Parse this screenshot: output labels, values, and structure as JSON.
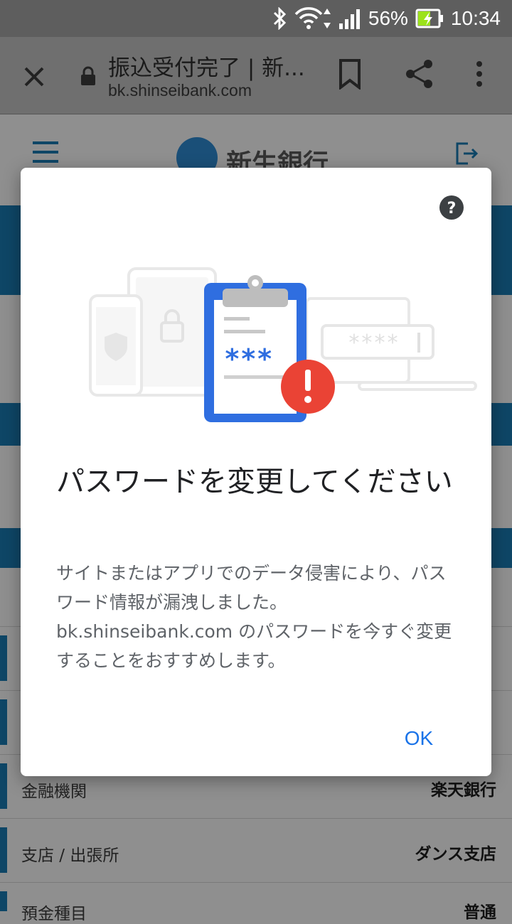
{
  "status_bar": {
    "battery_percent": "56%",
    "time": "10:34"
  },
  "browser": {
    "tab_title": "振込受付完了 | 新...",
    "url": "bk.shinseibank.com"
  },
  "page": {
    "logo_text": "新生銀行",
    "rows": [
      {
        "label": "金融機関",
        "value": "楽天銀行"
      },
      {
        "label": "支店 / 出張所",
        "value": "ダンス支店"
      },
      {
        "label": "預金種目",
        "value": "普通"
      }
    ]
  },
  "dialog": {
    "title": "パスワードを変更してください",
    "body": "サイトまたはアプリでのデータ侵害により、パスワード情報が漏洩しました。bk.shinseibank.com のパスワードを今すぐ変更することをおすすめします。",
    "ok_label": "OK",
    "illustration_clipboard_text": "***",
    "illustration_field_text": "****"
  },
  "colors": {
    "accent": "#1a73e8",
    "alert": "#ea4335",
    "bank_blue": "#0e4666"
  }
}
